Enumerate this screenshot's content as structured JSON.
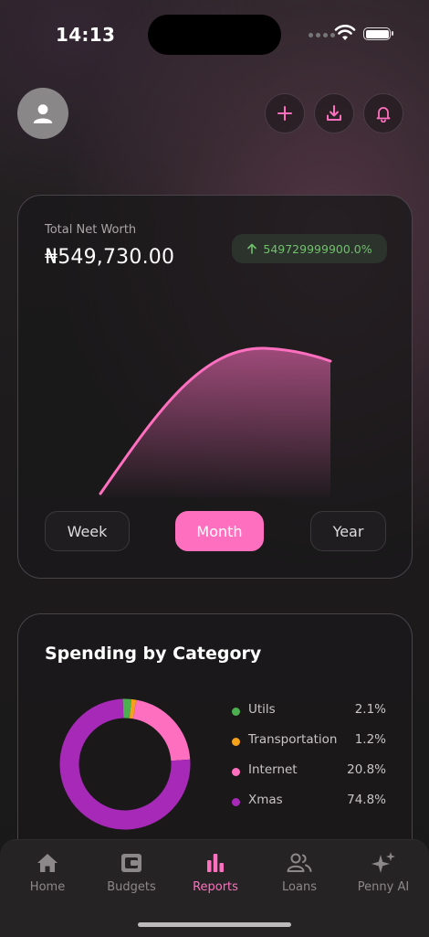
{
  "status": {
    "time": "14:13"
  },
  "header": {
    "avatar_icon": "person-icon",
    "actions": [
      "plus-icon",
      "download-icon",
      "bell-icon"
    ]
  },
  "net_worth": {
    "label": "Total Net Worth",
    "value": "₦549,730.00",
    "change": "549729999900.0%",
    "change_color": "#6fc06a",
    "periods": [
      "Week",
      "Month",
      "Year"
    ],
    "selected_period": "Month",
    "accent": "#ff6fc0"
  },
  "spending": {
    "title": "Spending by Category",
    "categories": [
      {
        "name": "Utils",
        "percent": "2.1%",
        "value": 2.1,
        "color": "#4caf50"
      },
      {
        "name": "Transportation",
        "percent": "1.2%",
        "value": 1.2,
        "color": "#f5a11a"
      },
      {
        "name": "Internet",
        "percent": "20.8%",
        "value": 20.8,
        "color": "#ff6fc0"
      },
      {
        "name": "Xmas",
        "percent": "74.8%",
        "value": 74.8,
        "color": "#a729b8"
      }
    ]
  },
  "tabs": [
    {
      "label": "Home",
      "icon": "home-icon"
    },
    {
      "label": "Budgets",
      "icon": "wallet-icon"
    },
    {
      "label": "Reports",
      "icon": "bar-chart-icon",
      "active": true
    },
    {
      "label": "Loans",
      "icon": "people-icon"
    },
    {
      "label": "Penny AI",
      "icon": "sparkles-icon"
    }
  ]
}
